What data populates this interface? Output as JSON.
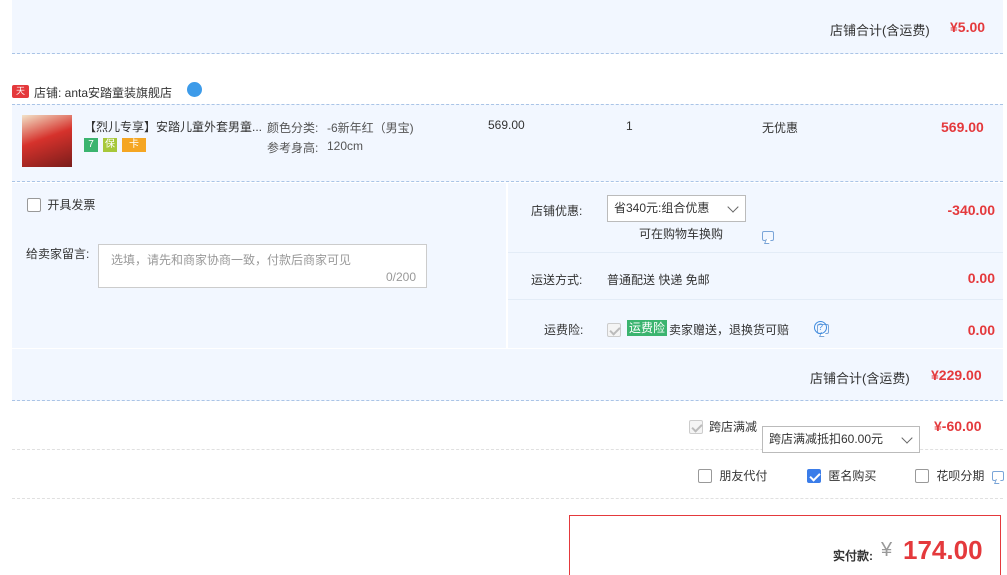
{
  "top_total": {
    "label": "店铺合计(含运费)",
    "value": "¥5.00"
  },
  "shop": {
    "badge": "天猫",
    "name": "店铺: anta安踏童装旗舰店"
  },
  "item": {
    "title": "【烈儿专享】安踏儿童外套男童...",
    "color_label": "颜色分类:",
    "color_value": "-6新年红（男宝)",
    "size_label": "参考身高:",
    "size_value": "120cm",
    "price": "569.00",
    "qty": "1",
    "discount": "无优惠",
    "subtotal": "569.00",
    "badges": [
      "7",
      "保",
      "卡"
    ]
  },
  "invoice": {
    "label": "开具发票"
  },
  "message": {
    "label": "给卖家留言:",
    "placeholder": "选填，请先和商家协商一致，付款后商家可见",
    "counter": "0/200"
  },
  "shop_discount": {
    "label": "店铺优惠:",
    "select": "省340元:组合优惠",
    "hint": "可在购物车换购",
    "value": "-340.00"
  },
  "shipping": {
    "label": "运送方式:",
    "text": "普通配送 快递 免邮",
    "value": "0.00"
  },
  "insurance": {
    "label": "运费险:",
    "tag": "运费险",
    "text": "卖家赠送，退换货可赔",
    "value": "0.00"
  },
  "shop_total": {
    "label": "店铺合计(含运费)",
    "value": "¥229.00"
  },
  "cross_store": {
    "label": "跨店满减",
    "select": "跨店满减抵扣60.00元",
    "value": "¥-60.00"
  },
  "options": {
    "friend_pay": "朋友代付",
    "anonymous": "匿名购买",
    "huabei": "花呗分期"
  },
  "payment": {
    "label": "实付款:",
    "currency": "¥",
    "value": "174.00"
  },
  "colors": {
    "accent_red": "#e4393c",
    "blue_bg": "#f2f7ff",
    "check_blue": "#3b7de9"
  }
}
